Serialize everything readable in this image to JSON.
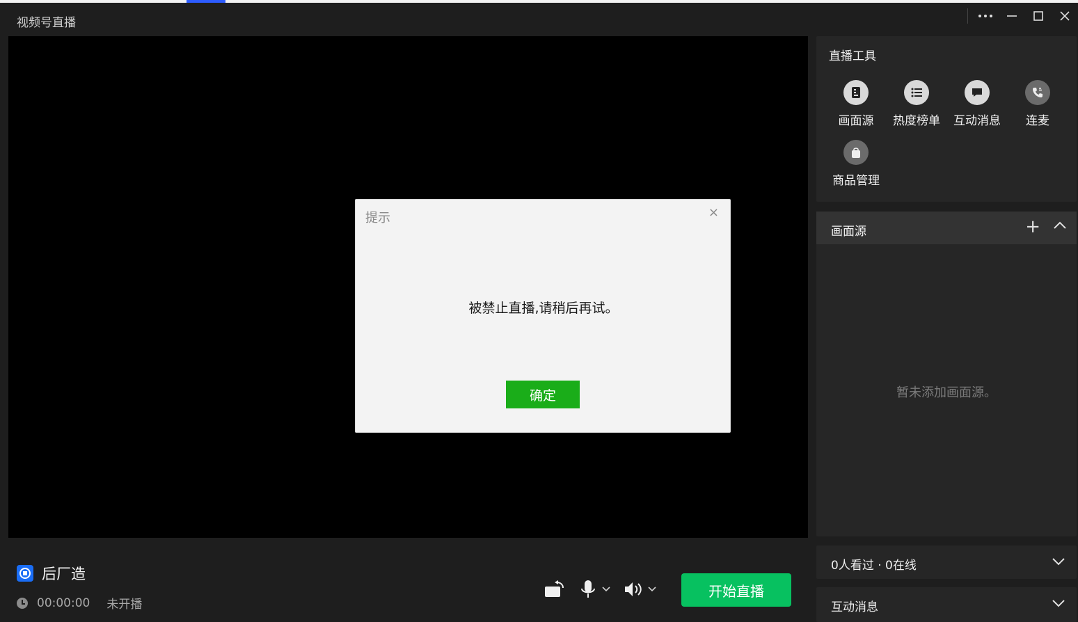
{
  "app": {
    "title": "视频号直播"
  },
  "tools": {
    "title": "直播工具",
    "items": [
      {
        "label": "画面源",
        "icon": "document-icon"
      },
      {
        "label": "热度榜单",
        "icon": "list-icon"
      },
      {
        "label": "互动消息",
        "icon": "chat-icon"
      },
      {
        "label": "连麦",
        "icon": "phone-icon"
      },
      {
        "label": "商品管理",
        "icon": "bag-icon"
      }
    ]
  },
  "sources": {
    "title": "画面源",
    "add_icon": "+",
    "empty_text": "暂未添加画面源。"
  },
  "viewers": {
    "text": "0人看过 · 0在线"
  },
  "messages": {
    "title": "互动消息"
  },
  "anchor": {
    "name": "后厂造"
  },
  "status": {
    "time": "00:00:00",
    "state": "未开播"
  },
  "controls": {
    "start_label": "开始直播"
  },
  "dialog": {
    "title": "提示",
    "close": "×",
    "message": "被禁止直播,请稍后再试。",
    "ok_label": "确定"
  },
  "colors": {
    "accent": "#07c160",
    "dialog_ok": "#1aad19",
    "avatar": "#1a6df5"
  }
}
